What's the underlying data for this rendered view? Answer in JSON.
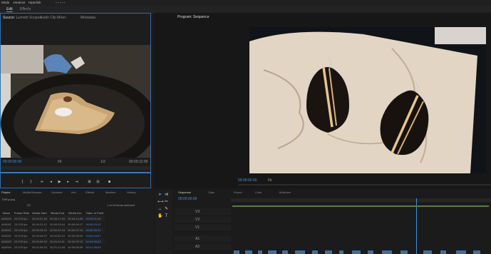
{
  "menu": [
    "Mode",
    "Aseance",
    "Hiperlink"
  ],
  "workspace_tabs": [
    {
      "label": "Edit",
      "active": true
    },
    {
      "label": "Effects",
      "active": false
    }
  ],
  "window_title": "",
  "source": {
    "tabs": [
      "Source: ...",
      "Lumetri Scopes",
      "Audio Clip Mixer",
      "Metadata"
    ],
    "timecode_left": "00:00:00:00",
    "timecode_right": "00:00:12:00",
    "fit": "Fit",
    "ratio": "1/2"
  },
  "program": {
    "tab": "Program: Sequence",
    "timecode": "00:00:00:00",
    "fit": "Fit"
  },
  "project": {
    "tabs": [
      "Project",
      "Media Browser",
      "Libraries",
      "Info",
      "Effects",
      "Markers",
      "History"
    ],
    "path": "TMP.prproj",
    "items_count": "1 of 16 items selected",
    "columns": [
      "Name",
      "Frame Rate",
      "Media Start",
      "Media End",
      "Media Dur.",
      "Video In Point"
    ],
    "rows": [
      [
        "A00049",
        "23.976 fps",
        "00:00:01:05",
        "00:00:17:09",
        "00:00:14:08",
        "00:00:01:05"
      ],
      [
        "A00050",
        "23.976 fps",
        "00:00:23:12",
        "00:00:33:04",
        "00:00:09:17",
        "00:00:23:12"
      ],
      [
        "A00051",
        "23.976 fps",
        "00:00:35:01",
        "00:00:42:16",
        "00:00:07:16",
        "00:00:35:01"
      ],
      [
        "A00052",
        "23.976 fps",
        "00:00:44:07",
        "00:00:52:10",
        "00:00:08:04",
        "00:00:44:07"
      ],
      [
        "A00053",
        "23.976 fps",
        "00:00:55:02",
        "00:01:04:11",
        "00:00:09:10",
        "00:00:55:02"
      ],
      [
        "A00054",
        "23.976 fps",
        "00:01:06:03",
        "00:01:12:08",
        "00:00:06:06",
        "00:01:06:03"
      ]
    ]
  },
  "timeline": {
    "tabs": [
      "Sequence",
      "Clips",
      "Export",
      "Color",
      "Multicam"
    ],
    "timecode": "00:00:00:00",
    "tracks": [
      "V3",
      "V2",
      "V1",
      "A1",
      "A2"
    ]
  },
  "colors": {
    "accent": "#3a78b8",
    "clip_video": "#3d6e9e",
    "clip_audio": "#5e7d3a"
  }
}
